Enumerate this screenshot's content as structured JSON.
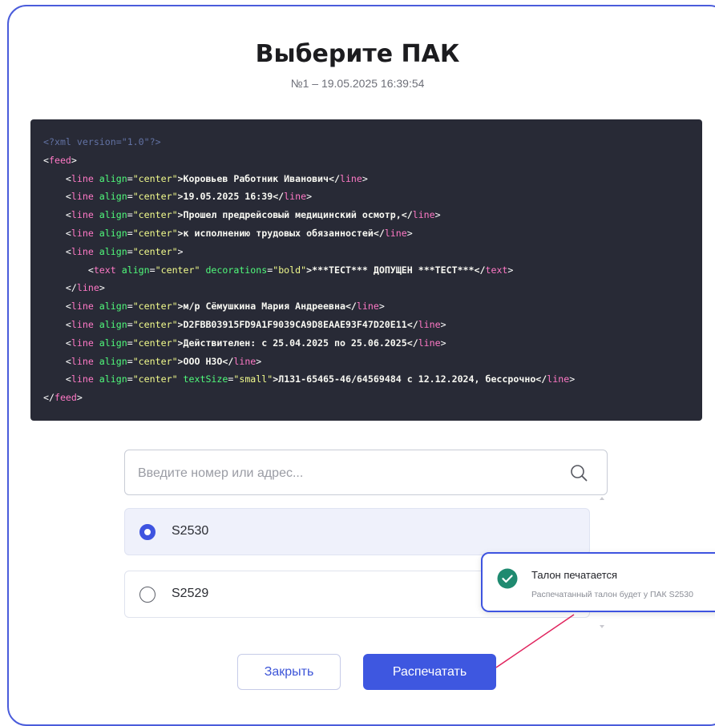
{
  "dialog": {
    "title": "Выберите ПАК",
    "subtitle": "№1 – 19.05.2025 16:39:54"
  },
  "code": {
    "lines": [
      [
        {
          "t": "<?xml version=\"1.0\"?>",
          "c": "comment"
        }
      ],
      [
        {
          "t": "<",
          "c": "plain"
        },
        {
          "t": "feed",
          "c": "tag"
        },
        {
          "t": ">",
          "c": "plain"
        }
      ],
      [
        {
          "t": "    <",
          "c": "plain"
        },
        {
          "t": "line",
          "c": "tag"
        },
        {
          "t": " align",
          "c": "attr"
        },
        {
          "t": "=",
          "c": "plain"
        },
        {
          "t": "\"center\"",
          "c": "val"
        },
        {
          "t": ">Коровьев Работник Иванович</",
          "c": "text"
        },
        {
          "t": "line",
          "c": "tag"
        },
        {
          "t": ">",
          "c": "plain"
        }
      ],
      [
        {
          "t": "    <",
          "c": "plain"
        },
        {
          "t": "line",
          "c": "tag"
        },
        {
          "t": " align",
          "c": "attr"
        },
        {
          "t": "=",
          "c": "plain"
        },
        {
          "t": "\"center\"",
          "c": "val"
        },
        {
          "t": ">19.05.2025 16:39</",
          "c": "text"
        },
        {
          "t": "line",
          "c": "tag"
        },
        {
          "t": ">",
          "c": "plain"
        }
      ],
      [
        {
          "t": "    <",
          "c": "plain"
        },
        {
          "t": "line",
          "c": "tag"
        },
        {
          "t": " align",
          "c": "attr"
        },
        {
          "t": "=",
          "c": "plain"
        },
        {
          "t": "\"center\"",
          "c": "val"
        },
        {
          "t": ">Прошел предрейсовый медицинский осмотр,</",
          "c": "text"
        },
        {
          "t": "line",
          "c": "tag"
        },
        {
          "t": ">",
          "c": "plain"
        }
      ],
      [
        {
          "t": "    <",
          "c": "plain"
        },
        {
          "t": "line",
          "c": "tag"
        },
        {
          "t": " align",
          "c": "attr"
        },
        {
          "t": "=",
          "c": "plain"
        },
        {
          "t": "\"center\"",
          "c": "val"
        },
        {
          "t": ">к исполнению трудовых обязанностей</",
          "c": "text"
        },
        {
          "t": "line",
          "c": "tag"
        },
        {
          "t": ">",
          "c": "plain"
        }
      ],
      [
        {
          "t": "    <",
          "c": "plain"
        },
        {
          "t": "line",
          "c": "tag"
        },
        {
          "t": " align",
          "c": "attr"
        },
        {
          "t": "=",
          "c": "plain"
        },
        {
          "t": "\"center\"",
          "c": "val"
        },
        {
          "t": ">",
          "c": "plain"
        }
      ],
      [
        {
          "t": "        <",
          "c": "plain"
        },
        {
          "t": "text",
          "c": "tag"
        },
        {
          "t": " align",
          "c": "attr"
        },
        {
          "t": "=",
          "c": "plain"
        },
        {
          "t": "\"center\"",
          "c": "val"
        },
        {
          "t": " decorations",
          "c": "attr"
        },
        {
          "t": "=",
          "c": "plain"
        },
        {
          "t": "\"bold\"",
          "c": "val"
        },
        {
          "t": ">***ТЕСТ*** ДОПУЩЕН ***ТЕСТ***</",
          "c": "text"
        },
        {
          "t": "text",
          "c": "tag"
        },
        {
          "t": ">",
          "c": "plain"
        }
      ],
      [
        {
          "t": "    </",
          "c": "plain"
        },
        {
          "t": "line",
          "c": "tag"
        },
        {
          "t": ">",
          "c": "plain"
        }
      ],
      [
        {
          "t": "    <",
          "c": "plain"
        },
        {
          "t": "line",
          "c": "tag"
        },
        {
          "t": " align",
          "c": "attr"
        },
        {
          "t": "=",
          "c": "plain"
        },
        {
          "t": "\"center\"",
          "c": "val"
        },
        {
          "t": ">м/р Сёмушкина Мария Андреевна</",
          "c": "text"
        },
        {
          "t": "line",
          "c": "tag"
        },
        {
          "t": ">",
          "c": "plain"
        }
      ],
      [
        {
          "t": "    <",
          "c": "plain"
        },
        {
          "t": "line",
          "c": "tag"
        },
        {
          "t": " align",
          "c": "attr"
        },
        {
          "t": "=",
          "c": "plain"
        },
        {
          "t": "\"center\"",
          "c": "val"
        },
        {
          "t": ">D2FBB03915FD9A1F9039CA9D8EAAE93F47D20E11</",
          "c": "text"
        },
        {
          "t": "line",
          "c": "tag"
        },
        {
          "t": ">",
          "c": "plain"
        }
      ],
      [
        {
          "t": "    <",
          "c": "plain"
        },
        {
          "t": "line",
          "c": "tag"
        },
        {
          "t": " align",
          "c": "attr"
        },
        {
          "t": "=",
          "c": "plain"
        },
        {
          "t": "\"center\"",
          "c": "val"
        },
        {
          "t": ">Действителен: с 25.04.2025 по 25.06.2025</",
          "c": "text"
        },
        {
          "t": "line",
          "c": "tag"
        },
        {
          "t": ">",
          "c": "plain"
        }
      ],
      [
        {
          "t": "    <",
          "c": "plain"
        },
        {
          "t": "line",
          "c": "tag"
        },
        {
          "t": " align",
          "c": "attr"
        },
        {
          "t": "=",
          "c": "plain"
        },
        {
          "t": "\"center\"",
          "c": "val"
        },
        {
          "t": ">ООО НЗО</",
          "c": "text"
        },
        {
          "t": "line",
          "c": "tag"
        },
        {
          "t": ">",
          "c": "plain"
        }
      ],
      [
        {
          "t": "    <",
          "c": "plain"
        },
        {
          "t": "line",
          "c": "tag"
        },
        {
          "t": " align",
          "c": "attr"
        },
        {
          "t": "=",
          "c": "plain"
        },
        {
          "t": "\"center\"",
          "c": "val"
        },
        {
          "t": " textSize",
          "c": "attr"
        },
        {
          "t": "=",
          "c": "plain"
        },
        {
          "t": "\"small\"",
          "c": "val"
        },
        {
          "t": ">Л131-65465-46/64569484 с 12.12.2024, бессрочно</",
          "c": "text"
        },
        {
          "t": "line",
          "c": "tag"
        },
        {
          "t": ">",
          "c": "plain"
        }
      ],
      [
        {
          "t": "</",
          "c": "plain"
        },
        {
          "t": "feed",
          "c": "tag"
        },
        {
          "t": ">",
          "c": "plain"
        }
      ]
    ]
  },
  "search": {
    "placeholder": "Введите номер или адрес...",
    "value": ""
  },
  "options": [
    {
      "label": "S2530",
      "selected": true
    },
    {
      "label": "S2529",
      "selected": false
    }
  ],
  "buttons": {
    "close_label": "Закрыть",
    "print_label": "Распечатать"
  },
  "toast": {
    "title": "Талон печатается",
    "message": "Распечатанный талон будет у ПАК S2530"
  },
  "colors": {
    "accent": "#3e54e0",
    "success": "#1f8a70",
    "code_bg": "#282a36"
  }
}
